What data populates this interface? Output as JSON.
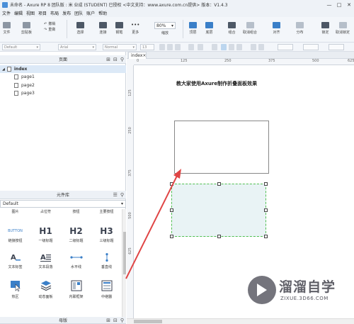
{
  "window": {
    "title": "未命名 - Axure RP 8 团队版 : 米 业成 (STUDENT) 已授权   <中文支持：www.axure.com.cn提供> 版本：V1.4.3",
    "controls": [
      "—",
      "□",
      "✕"
    ]
  },
  "menu": [
    "文件",
    "编辑",
    "视图",
    "项目",
    "布局",
    "发布",
    "团队",
    "账户",
    "帮助"
  ],
  "toolbar": {
    "file": "文件",
    "clipboard": "剪贴板",
    "undo": "撤销",
    "redo": "重做",
    "select": "选择",
    "connect": "连接",
    "pen": "钢笔",
    "more": "更多",
    "zoom_value": "80%",
    "zoom_label": "缩放",
    "top": "顶层",
    "bottom": "底层",
    "group": "组合",
    "ungroup": "取消组合",
    "align": "对齐",
    "distribute": "分布",
    "lock": "锁定",
    "unlock": "取消锁定"
  },
  "format": {
    "style": "Default",
    "font": "Arial",
    "weight": "Normal",
    "size": "13"
  },
  "pages_panel": {
    "title": "页面",
    "pages": [
      {
        "label": "index",
        "selected": true
      },
      {
        "label": "page1",
        "selected": false
      },
      {
        "label": "page2",
        "selected": false
      },
      {
        "label": "page3",
        "selected": false
      }
    ]
  },
  "library_panel": {
    "title": "元件库",
    "library": "Default",
    "partial_row": [
      "图片",
      "占位符",
      "按钮",
      "主要按钮"
    ],
    "items": [
      {
        "label": "链接按钮",
        "icon": "BUTTON"
      },
      {
        "label": "一级标题",
        "icon": "H1"
      },
      {
        "label": "二级标题",
        "icon": "H2"
      },
      {
        "label": "三级标题",
        "icon": "H3"
      },
      {
        "label": "文本标签",
        "icon": "text-label-icon"
      },
      {
        "label": "文本段落",
        "icon": "paragraph-icon"
      },
      {
        "label": "水平线",
        "icon": "horizontal-line-icon"
      },
      {
        "label": "垂直线",
        "icon": "vertical-line-icon"
      },
      {
        "label": "热区",
        "icon": "hotspot-icon"
      },
      {
        "label": "动态面板",
        "icon": "dynamic-panel-icon"
      },
      {
        "label": "内联框架",
        "icon": "inline-frame-icon"
      },
      {
        "label": "中继器",
        "icon": "repeater-icon"
      }
    ]
  },
  "masters_panel": {
    "title": "母版"
  },
  "canvas": {
    "tab": "index",
    "ruler_h": [
      "0",
      "125",
      "250",
      "375",
      "500",
      "625"
    ],
    "ruler_v": [
      "125",
      "250",
      "375",
      "500",
      "625"
    ],
    "heading": "教大家使用Axure制作折叠面板效果"
  },
  "watermark": {
    "name": "溜溜自学",
    "url": "ZIXUE.3D66.COM"
  },
  "colors": {
    "accent": "#3a7fc8",
    "arrow": "#e04545",
    "panel_border": "#4fbf4f",
    "panel_fill": "#e9f3f5"
  }
}
